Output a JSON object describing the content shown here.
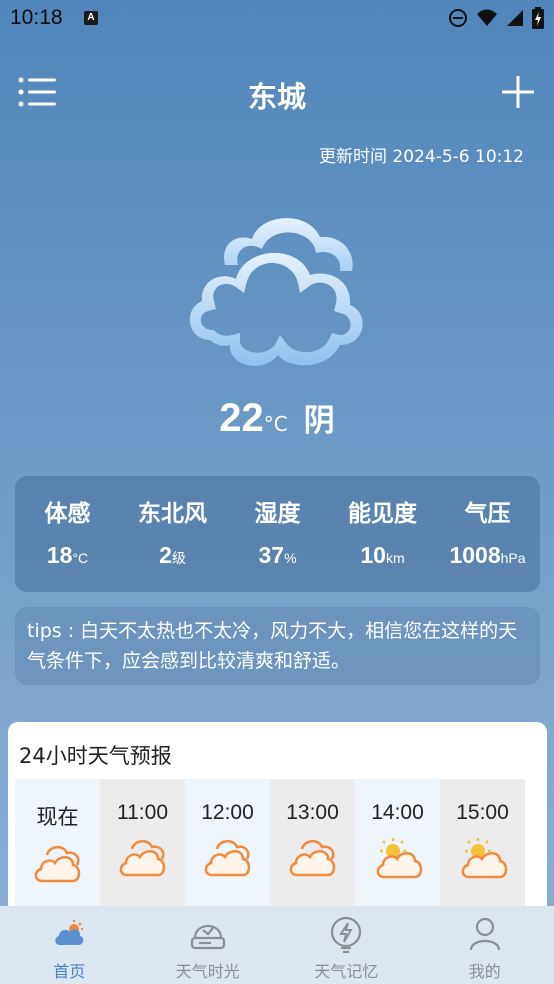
{
  "status_bar": {
    "time": "10:18",
    "notif_glyph": "A",
    "icons": [
      "dnd-icon",
      "wifi-icon",
      "signal-icon",
      "battery-icon"
    ]
  },
  "header": {
    "city": "东城",
    "menu_icon": "menu-icon",
    "add_icon": "plus-icon"
  },
  "update_time": "更新时间 2024-5-6 10:12",
  "current": {
    "icon": "overcast-cloud-icon",
    "temp": "22",
    "unit": "°C",
    "condition": "阴"
  },
  "stats": [
    {
      "label": "体感",
      "value": "18",
      "unit": "°C"
    },
    {
      "label": "东北风",
      "value": "2",
      "unit": "级"
    },
    {
      "label": "湿度",
      "value": "37",
      "unit": "%"
    },
    {
      "label": "能见度",
      "value": "10",
      "unit": "km"
    },
    {
      "label": "气压",
      "value": "1008",
      "unit": "hPa"
    }
  ],
  "tips": "tips : 白天不太热也不太冷，风力不大，相信您在这样的天气条件下，应会感到比较清爽和舒适。",
  "forecast": {
    "title": "24小时天气预报",
    "hours": [
      {
        "time": "现在",
        "icon": "cloudy-icon"
      },
      {
        "time": "11:00",
        "icon": "cloudy-icon"
      },
      {
        "time": "12:00",
        "icon": "cloudy-icon"
      },
      {
        "time": "13:00",
        "icon": "cloudy-icon"
      },
      {
        "time": "14:00",
        "icon": "partly-sunny-icon"
      },
      {
        "time": "15:00",
        "icon": "partly-sunny-icon"
      }
    ]
  },
  "nav": [
    {
      "label": "首页",
      "icon": "home-weather-icon",
      "active": true
    },
    {
      "label": "天气时光",
      "icon": "weather-time-icon",
      "active": false
    },
    {
      "label": "天气记忆",
      "icon": "weather-memory-icon",
      "active": false
    },
    {
      "label": "我的",
      "icon": "profile-icon",
      "active": false
    }
  ],
  "colors": {
    "accent": "#4a82c0",
    "cloud_icon_orange": "#f08a3c",
    "sun_yellow": "#f5c23a"
  }
}
